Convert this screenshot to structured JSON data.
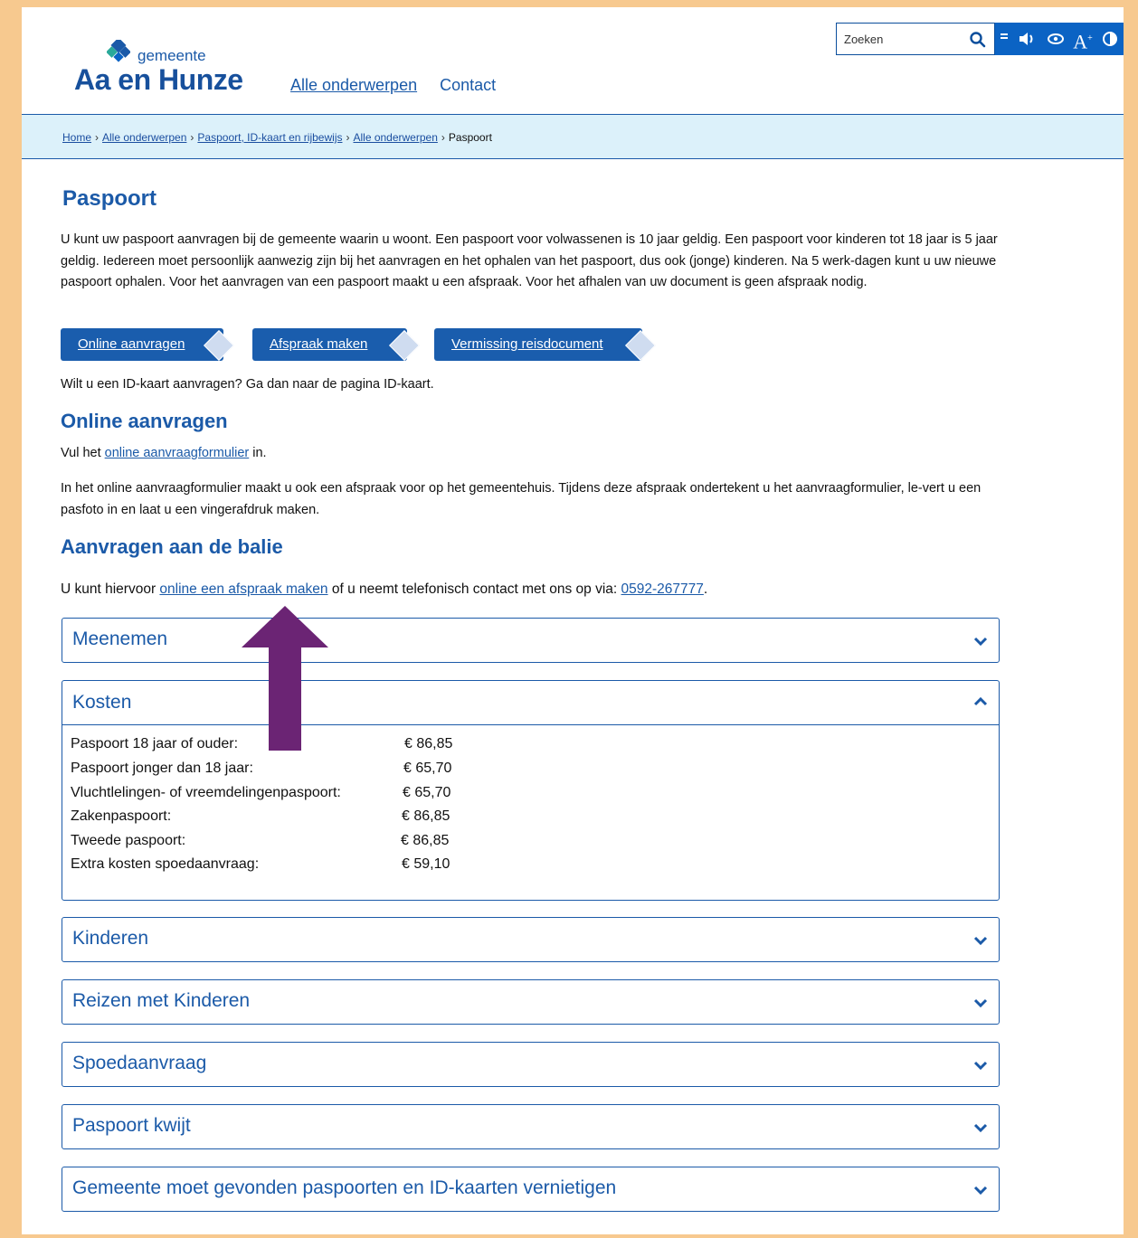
{
  "header": {
    "logo_top": "gemeente",
    "logo_main": "Aa en Hunze",
    "nav": [
      "Alle onderwerpen",
      "Contact"
    ],
    "search_placeholder": "Zoeken"
  },
  "breadcrumb": {
    "items": [
      "Home",
      "Alle onderwerpen",
      "Paspoort, ID-kaart en rijbewijs",
      "Alle onderwerpen"
    ],
    "current": "Paspoort",
    "separator": "›"
  },
  "main": {
    "title": "Paspoort",
    "intro": "U kunt uw paspoort aanvragen bij de gemeente waarin u woont. Een paspoort voor volwassenen is 10 jaar geldig. Een paspoort voor kinderen tot 18 jaar is 5 jaar geldig. Iedereen moet persoonlijk aanwezig zijn bij het aanvragen en het ophalen van het paspoort, dus ook (jonge) kinderen. Na 5 werk-dagen kunt u uw nieuwe paspoort ophalen. Voor het aanvragen van een paspoort maakt u een afspraak. Voor het afhalen van uw document is geen afspraak nodig.",
    "buttons": [
      "Online aanvragen",
      "Afspraak maken",
      "Vermissing reisdocument"
    ],
    "idkaart_note": "Wilt u een ID-kaart aanvragen? Ga dan naar de pagina ID-kaart.",
    "online": {
      "heading": "Online aanvragen",
      "line_pre": "Vul het ",
      "line_link": "online aanvraagformulier",
      "line_post": " in.",
      "paragraph": "In het online aanvraagformulier maakt u ook een afspraak voor op het gemeentehuis. Tijdens deze afspraak ondertekent u het aanvraagformulier, le-vert u een pasfoto in en laat u een vingerafdruk maken."
    },
    "balie": {
      "heading": "Aanvragen aan de balie",
      "pre": "U kunt hiervoor ",
      "link": "online een afspraak maken",
      "mid": " of u neemt telefonisch contact met ons op via: ",
      "phone": "0592-267777",
      "post": "."
    },
    "accordions": {
      "meenemen": "Meenemen",
      "kosten": "Kosten",
      "kinderen": "Kinderen",
      "reizen": "Reizen met Kinderen",
      "spoed": "Spoedaanvraag",
      "kwijt": "Paspoort kwijt",
      "vernietigen": "Gemeente moet gevonden paspoorten en ID-kaarten vernietigen"
    },
    "kosten": [
      {
        "label": "Paspoort 18 jaar of ouder:",
        "value": "€ 86,85"
      },
      {
        "label": "Paspoort jonger dan 18 jaar:",
        "value": "€ 65,70"
      },
      {
        "label": "Vluchtlelingen- of vreemdelingenpaspoort:",
        "value": "€ 65,70"
      },
      {
        "label": "Zakenpaspoort:",
        "value": "€ 86,85"
      },
      {
        "label": "Tweede paspoort:",
        "value": "€ 86,85"
      },
      {
        "label": "Extra kosten spoedaanvraag:",
        "value": "€ 59,10"
      }
    ]
  },
  "annotation": {
    "arrow_color": "#6b2474"
  },
  "colors": {
    "brand_blue": "#1b5aa8",
    "toolbar_blue": "#0b63c4",
    "breadcrumb_bg": "#dcf1fa",
    "frame": "#f7c98f"
  }
}
